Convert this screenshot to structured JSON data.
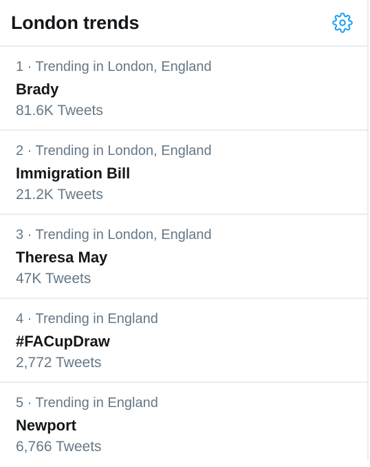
{
  "header": {
    "title": "London trends",
    "settings_icon": "gear-icon"
  },
  "colors": {
    "accent": "#1da1f2",
    "secondary_text": "#657786",
    "primary_text": "#14171a",
    "divider": "#e6ecf0"
  },
  "trends": [
    {
      "rank": "1",
      "separator": " · ",
      "context": "Trending in London, England",
      "name": "Brady",
      "tweets": "81.6K Tweets"
    },
    {
      "rank": "2",
      "separator": " · ",
      "context": "Trending in London, England",
      "name": "Immigration Bill",
      "tweets": "21.2K Tweets"
    },
    {
      "rank": "3",
      "separator": " · ",
      "context": "Trending in London, England",
      "name": "Theresa May",
      "tweets": "47K Tweets"
    },
    {
      "rank": "4",
      "separator": " · ",
      "context": "Trending in England",
      "name": "#FACupDraw",
      "tweets": "2,772 Tweets"
    },
    {
      "rank": "5",
      "separator": " · ",
      "context": "Trending in England",
      "name": "Newport",
      "tweets": "6,766 Tweets"
    }
  ]
}
